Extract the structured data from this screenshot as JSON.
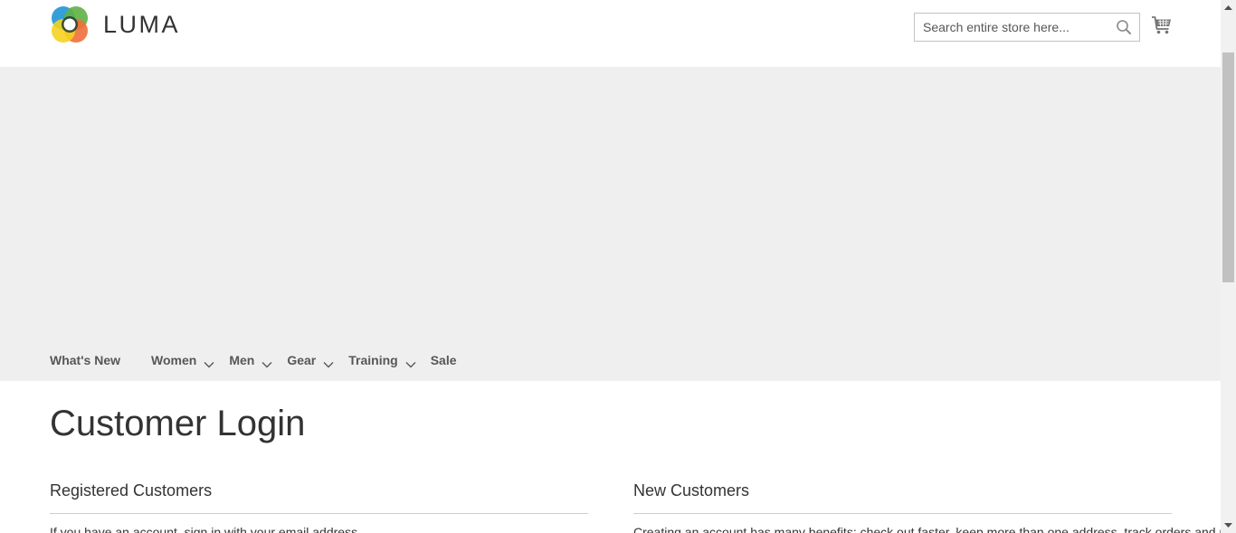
{
  "header": {
    "logo_text": "LUMA",
    "search": {
      "placeholder": "Search entire store here...",
      "value": ""
    }
  },
  "nav": {
    "items": [
      {
        "label": "What's New",
        "has_dropdown": false
      },
      {
        "label": "Women",
        "has_dropdown": true
      },
      {
        "label": "Men",
        "has_dropdown": true
      },
      {
        "label": "Gear",
        "has_dropdown": true
      },
      {
        "label": "Training",
        "has_dropdown": true
      },
      {
        "label": "Sale",
        "has_dropdown": false
      }
    ]
  },
  "main": {
    "page_title": "Customer Login",
    "registered": {
      "title": "Registered Customers",
      "text": "If you have an account, sign in with your email address."
    },
    "new_customers": {
      "title": "New Customers",
      "text": "Creating an account has many benefits: check out faster, keep more than one address, track orders and more."
    }
  },
  "icons": {
    "search": "search-icon",
    "cart": "cart-icon",
    "chevron": "chevron-down-icon",
    "logo": "luma-logo-icon"
  },
  "colors": {
    "banner_bg": "#efefef",
    "nav_text": "#575757",
    "heading": "#333333",
    "divider": "#cccccc"
  }
}
